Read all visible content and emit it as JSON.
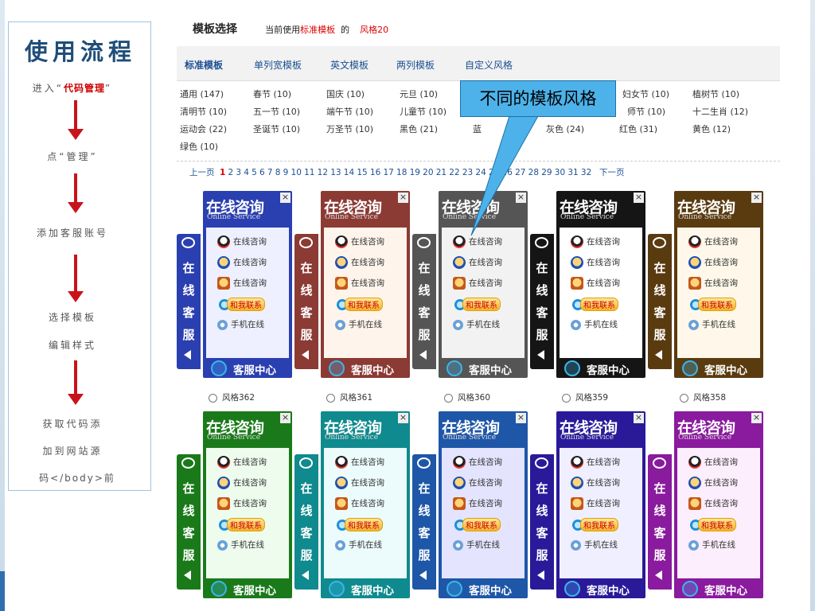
{
  "process": {
    "title": "使用流程",
    "step1_pre": "进入“",
    "step1_link": "代码管理",
    "step1_post": "”",
    "step2": "点“管理”",
    "step3": "添加客服账号",
    "step4a": "选择模板",
    "step4b": "编辑样式",
    "step5a": "获取代码添",
    "step5b": "加到网站源",
    "step5c": "码</body>前"
  },
  "header": {
    "title": "模板选择",
    "current_prefix": "当前使用",
    "current_tpl": "标准模板",
    "current_mid": "的",
    "current_style": "风格20"
  },
  "tabs": [
    "标准模板",
    "单列宽模板",
    "英文模板",
    "两列模板",
    "自定义风格"
  ],
  "categories": [
    [
      "通用 (147)",
      "春节 (10)",
      "国庆 (10)",
      "元旦 (10)",
      "",
      "",
      "妇女节 (10)",
      "植树节 (10)"
    ],
    [
      "清明节 (10)",
      "五一节 (10)",
      "端午节 (10)",
      "儿童节 (10)",
      "",
      "",
      "师节 (10)",
      "十二生肖 (12)"
    ],
    [
      "运动会 (22)",
      "圣诞节 (10)",
      "万圣节 (10)",
      "黑色 (21)",
      "蓝",
      "灰色 (24)",
      "红色 (31)",
      "黄色 (12)"
    ],
    [
      "绿色 (10)"
    ]
  ],
  "callout": "不同的模板风格",
  "pager": {
    "prev": "上一页",
    "pages": [
      "1",
      "2",
      "3",
      "4",
      "5",
      "6",
      "7",
      "8",
      "9",
      "10",
      "11",
      "12",
      "13",
      "14",
      "15",
      "16",
      "17",
      "18",
      "19",
      "20",
      "21",
      "22",
      "23",
      "24",
      "25",
      "26",
      "27",
      "28",
      "29",
      "30",
      "31",
      "32"
    ],
    "current": "1",
    "next": "下一页"
  },
  "widget": {
    "title": "在线咨询",
    "subtitle": "Online Service",
    "side_chars": [
      "在",
      "线",
      "客",
      "服"
    ],
    "rows": [
      "在线咨询",
      "在线咨询",
      "在线咨询"
    ],
    "contact": "和我联系",
    "mobile": "手机在线",
    "footer": "客服中心",
    "close": "×"
  },
  "styles": [
    {
      "label": "风格362",
      "color": "#2a3fb0",
      "light": "#eef0ff",
      "selected": false
    },
    {
      "label": "风格361",
      "color": "#8b3a34",
      "light": "#fff4ec",
      "selected": false
    },
    {
      "label": "风格360",
      "color": "#555555",
      "light": "#f2f2f2",
      "selected": false
    },
    {
      "label": "风格359",
      "color": "#151515",
      "light": "#ffffff",
      "selected": false
    },
    {
      "label": "风格358",
      "color": "#5a3b10",
      "light": "#fff8ea",
      "selected": false
    },
    {
      "label": "",
      "color": "#1a7a1a",
      "light": "#eefcee",
      "selected": false
    },
    {
      "label": "",
      "color": "#0f8a8e",
      "light": "#ecfbfb",
      "selected": false
    },
    {
      "label": "",
      "color": "#1e56a8",
      "light": "#e4e4ff",
      "selected": false
    },
    {
      "label": "",
      "color": "#2a1a9a",
      "light": "#f0efff",
      "selected": false
    },
    {
      "label": "",
      "color": "#8a1a9e",
      "light": "#fdeefd",
      "selected": false
    }
  ]
}
